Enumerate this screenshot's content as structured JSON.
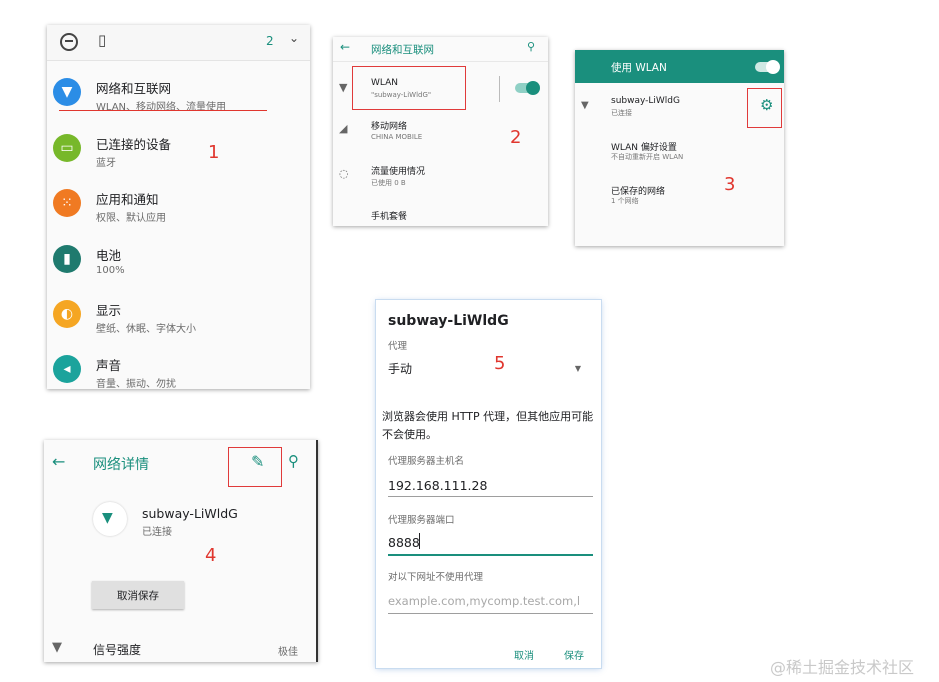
{
  "panel1": {
    "quick_settings": {
      "count": "2"
    },
    "items": [
      {
        "title": "网络和互联网",
        "subtitle": "WLAN、移动网络、流量使用",
        "icon": "wifi-icon",
        "color": "#2b8de6"
      },
      {
        "title": "已连接的设备",
        "subtitle": "蓝牙",
        "icon": "devices-icon",
        "color": "#77b82a"
      },
      {
        "title": "应用和通知",
        "subtitle": "权限、默认应用",
        "icon": "apps-icon",
        "color": "#f07a22"
      },
      {
        "title": "电池",
        "subtitle": "100%",
        "icon": "battery-icon",
        "color": "#1f7a6e"
      },
      {
        "title": "显示",
        "subtitle": "壁纸、休眠、字体大小",
        "icon": "display-icon",
        "color": "#f5a623"
      },
      {
        "title": "声音",
        "subtitle": "音量、振动、勿扰",
        "icon": "sound-icon",
        "color": "#1ba39c"
      }
    ],
    "step": "1"
  },
  "panel2": {
    "title": "网络和互联网",
    "items": [
      {
        "title": "WLAN",
        "subtitle": "\"subway-LiWldG\""
      },
      {
        "title": "移动网络",
        "subtitle": "CHINA MOBILE"
      },
      {
        "title": "流量使用情况",
        "subtitle": "已使用 0 B"
      },
      {
        "title": "手机套餐",
        "subtitle": ""
      }
    ],
    "step": "2"
  },
  "panel3": {
    "header": "使用 WLAN",
    "network": {
      "name": "subway-LiWldG",
      "status": "已连接"
    },
    "items": [
      {
        "title": "WLAN 偏好设置",
        "subtitle": "不自动重新开启 WLAN"
      },
      {
        "title": "已保存的网络",
        "subtitle": "1 个网络"
      }
    ],
    "step": "3"
  },
  "panel4": {
    "title": "网络详情",
    "network": {
      "name": "subway-LiWldG",
      "status": "已连接"
    },
    "forget_label": "取消保存",
    "signal_label": "信号强度",
    "signal_value": "极佳",
    "step": "4"
  },
  "panel5": {
    "title": "subway-LiWldG",
    "proxy_label": "代理",
    "proxy_value": "手动",
    "note": "浏览器会使用 HTTP 代理，但其他应用可能不会使用。",
    "host_label": "代理服务器主机名",
    "host_value": "192.168.111.28",
    "port_label": "代理服务器端口",
    "port_value": "8888",
    "bypass_label": "对以下网址不使用代理",
    "bypass_placeholder": "example.com,mycomp.test.com,l",
    "cancel_label": "取消",
    "save_label": "保存",
    "step": "5"
  },
  "watermark": "@稀土掘金技术社区",
  "colors": {
    "accent": "#1a8f7d",
    "annotation": "#e0362e"
  }
}
